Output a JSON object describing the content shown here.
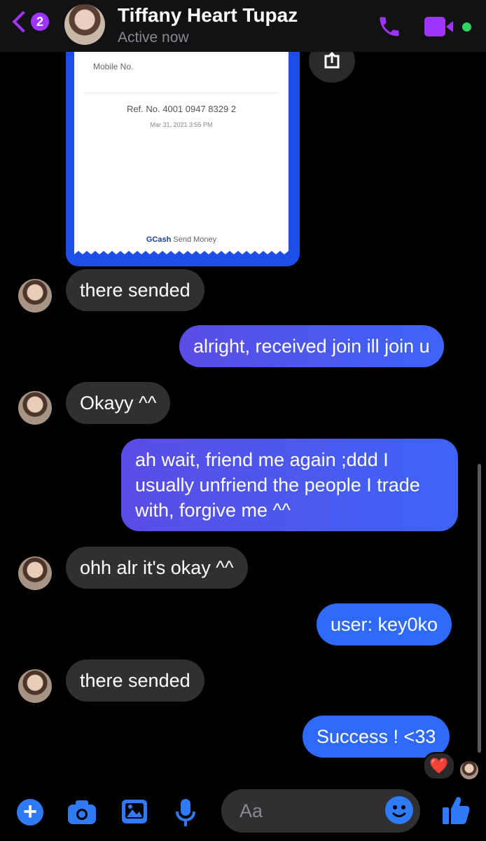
{
  "header": {
    "back_count": "2",
    "contact_name": "Tiffany Heart Tupaz",
    "status": "Active now",
    "accent_color": "#a034ff",
    "active_color": "#2fd561",
    "icons": [
      "back-chevron-icon",
      "phone-icon",
      "video-camera-icon"
    ]
  },
  "receipt": {
    "mobile_label": "Mobile No.",
    "ref_no": "Ref. No. 4001 0947 8329 2",
    "date": "Mar 31, 2021 3:55 PM",
    "brand": "GCash",
    "brand_suffix": "Send Money"
  },
  "messages": [
    {
      "from": "them",
      "text": "there sended"
    },
    {
      "from": "me",
      "text": "alright, received join ill join u"
    },
    {
      "from": "them",
      "text": "Okayy ^^"
    },
    {
      "from": "me",
      "text": "ah wait, friend me again ;ddd I usually unfriend the people I trade with, forgive me ^^"
    },
    {
      "from": "them",
      "text": "ohh alr it's okay ^^"
    },
    {
      "from": "me",
      "text": "user: key0ko"
    },
    {
      "from": "them",
      "text": "there sended"
    },
    {
      "from": "me",
      "text": "Success ! <33"
    }
  ],
  "reaction": "❤️",
  "composer": {
    "placeholder": "Aa",
    "icons": [
      "plus-icon",
      "camera-icon",
      "image-icon",
      "microphone-icon",
      "emoji-icon",
      "thumbs-up-icon"
    ]
  }
}
